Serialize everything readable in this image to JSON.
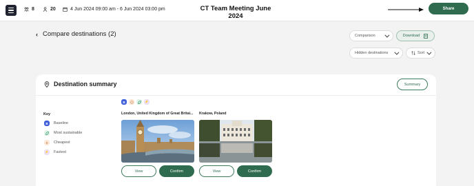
{
  "header": {
    "travellers_count": "8",
    "attendees_count": "20",
    "dates": "4 Jun 2024 09:00 am - 6 Jun 2024 03:00 pm",
    "title": "CT Team Meeting June 2024",
    "share_label": "Share"
  },
  "page": {
    "heading": "Compare destinations (2)",
    "comparison_label": "Comparison",
    "download_label": "Download",
    "hidden_destinations_label": "Hidden destinations",
    "sort_label": "Sort"
  },
  "summary": {
    "title": "Destination summary",
    "summary_button": "Summary",
    "key_title": "Key",
    "key_items": [
      {
        "badge": "B",
        "label": "Baseline"
      },
      {
        "badge": "",
        "label": "Most sustainable"
      },
      {
        "badge": "$",
        "label": "Cheapest"
      },
      {
        "badge": "⚡",
        "label": "Fastest"
      }
    ],
    "legend_badges": [
      "B",
      "",
      "",
      "⚡"
    ],
    "destinations": [
      {
        "name": "London, United Kingdom of Great Britai...",
        "view": "View",
        "confirm": "Confirm"
      },
      {
        "name": "Krakow, Poland",
        "view": "View",
        "confirm": "Confirm"
      }
    ]
  },
  "colors": {
    "brand_green": "#2f6b4f",
    "baseline_blue": "#3f5fd9",
    "sustainable_green": "#3a9b6a",
    "cheapest_orange": "#d58a50",
    "fastest_purple": "#8b5bc8"
  }
}
